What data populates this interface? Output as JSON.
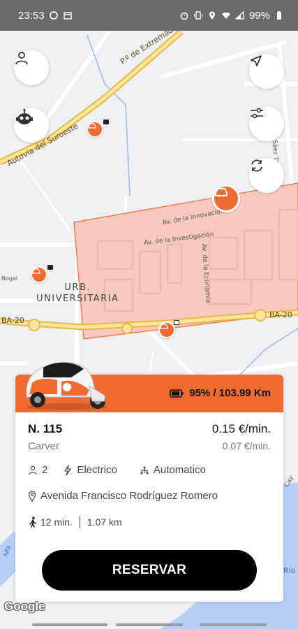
{
  "status_bar": {
    "time": "23:53",
    "battery": "99%"
  },
  "map": {
    "road_labels": [
      "P.º de Extremadura",
      "Autovía del Suroeste",
      "BA-20",
      "BA-20"
    ],
    "street_labels": [
      "Av. de la Innovación",
      "Av. de la Investigación",
      "Av. de la Economía",
      "C. Juan Sáez Tierno",
      "Nogal"
    ],
    "district": "URB.\nUNIVERSITARIA",
    "side_labels": [
      "Alfa",
      "Cay",
      "Río"
    ],
    "attribution": "Google"
  },
  "card": {
    "battery_text": "95% / 103.99 Km",
    "vehicle_name": "N. 115",
    "vehicle_model": "Carver",
    "price_per_min": "0.15 €/min.",
    "price_secondary": "0.07 €/min.",
    "seats": "2",
    "fuel": "Electrico",
    "transmission": "Automatico",
    "address": "Avenida Francisco Rodríguez Romero",
    "walk_time": "12 min.",
    "walk_distance": "1.07 km",
    "reserve_label": "RESERVAR"
  },
  "colors": {
    "brand_orange": "#f06b31",
    "zone_fill": "#f7c9bd",
    "zone_stroke": "#ee6c33"
  }
}
